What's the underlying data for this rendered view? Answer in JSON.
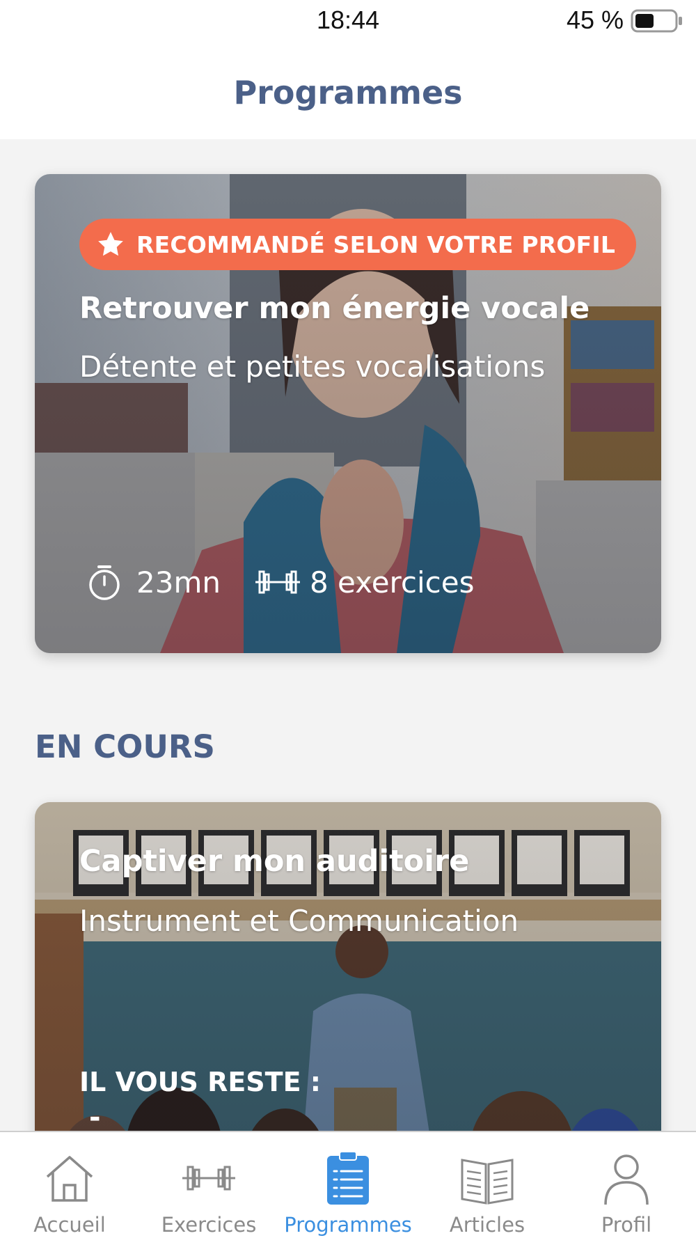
{
  "status_bar": {
    "time": "18:44",
    "battery": "45 %"
  },
  "header": {
    "title": "Programmes"
  },
  "recommended": {
    "badge": "RECOMMANDÉ SELON VOTRE PROFIL",
    "title": "Retrouver mon énergie vocale",
    "subtitle": "Détente et petites vocalisations",
    "duration": "23mn",
    "exercises": "8 exercices"
  },
  "in_progress": {
    "heading": "EN COURS",
    "title": "Captiver mon auditoire",
    "subtitle": "Instrument et Communication",
    "remaining_label": "IL VOUS RESTE :",
    "remaining_value": "-"
  },
  "tabs": [
    {
      "label": "Accueil",
      "icon": "home-icon",
      "active": false
    },
    {
      "label": "Exercices",
      "icon": "dumbbell-icon",
      "active": false
    },
    {
      "label": "Programmes",
      "icon": "clipboard-list-icon",
      "active": true
    },
    {
      "label": "Articles",
      "icon": "book-icon",
      "active": false
    },
    {
      "label": "Profil",
      "icon": "person-icon",
      "active": false
    }
  ],
  "colors": {
    "title": "#4b6088",
    "badge": "#f36c4c",
    "active_tab": "#3b8fe0",
    "inactive_tab": "#8a8a8a"
  }
}
